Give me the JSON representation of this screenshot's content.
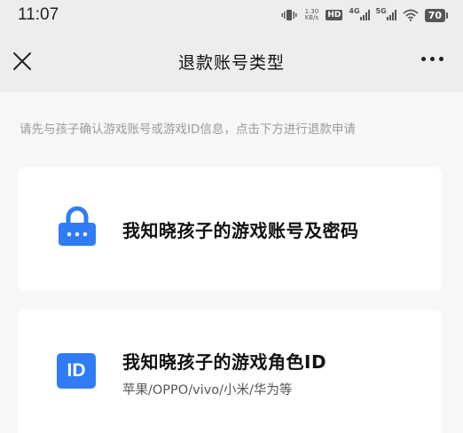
{
  "status_bar": {
    "time": "11:07",
    "speed_value": "1.30",
    "speed_unit": "KB/s",
    "hd_label": "HD",
    "network_1": "4G",
    "network_2": "5G",
    "battery": "70"
  },
  "nav": {
    "title": "退款账号类型"
  },
  "hint": "请先与孩子确认游戏账号或游戏ID信息，点击下方进行退款申请",
  "options": [
    {
      "title": "我知晓孩子的游戏账号及密码",
      "icon": "lock-icon"
    },
    {
      "title": "我知晓孩子的游戏角色ID",
      "subtitle": "苹果/OPPO/vivo/小米/华为等",
      "icon_text": "ID",
      "icon": "id-icon"
    }
  ],
  "colors": {
    "accent": "#2f7cf6",
    "page_bg": "#f7f7f7",
    "header_bg": "#ededed"
  }
}
